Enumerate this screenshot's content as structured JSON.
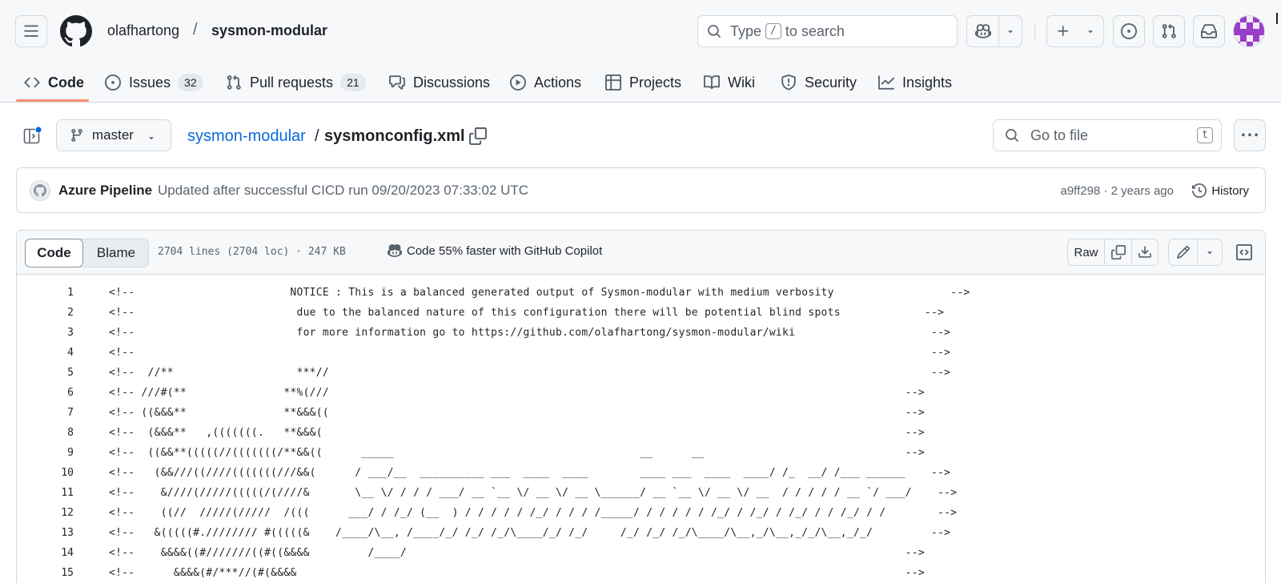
{
  "header": {
    "owner": "olafhartong",
    "separator": "/",
    "repo": "sysmon-modular",
    "search_prefix": "Type",
    "search_key": "/",
    "search_suffix": "to search"
  },
  "nav": {
    "code": "Code",
    "issues": "Issues",
    "issues_count": "32",
    "pull_requests": "Pull requests",
    "pull_requests_count": "21",
    "discussions": "Discussions",
    "actions": "Actions",
    "projects": "Projects",
    "wiki": "Wiki",
    "security": "Security",
    "insights": "Insights"
  },
  "file_header": {
    "branch": "master",
    "path_repo": "sysmon-modular",
    "path_sep": "/",
    "path_file": "sysmonconfig.xml",
    "goto_placeholder": "Go to file",
    "goto_key": "t"
  },
  "commit": {
    "author": "Azure Pipeline",
    "message": "Updated after successful CICD run 09/20/2023 07:33:02 UTC",
    "sha_time": "a9ff298 · 2 years ago",
    "history": "History"
  },
  "toolbar": {
    "code_tab": "Code",
    "blame_tab": "Blame",
    "meta": "2704 lines (2704 loc) · 247 KB",
    "copilot_hint": "Code 55% faster with GitHub Copilot",
    "raw": "Raw"
  },
  "code_lines": [
    {
      "n": "1",
      "text": "<!--                        NOTICE : This is a balanced generated output of Sysmon-modular with medium verbosity                  -->"
    },
    {
      "n": "2",
      "text": "<!--                         due to the balanced nature of this configuration there will be potential blind spots             -->"
    },
    {
      "n": "3",
      "text": "<!--                         for more information go to https://github.com/olafhartong/sysmon-modular/wiki                     -->"
    },
    {
      "n": "4",
      "text": "<!--                                                                                                                           -->"
    },
    {
      "n": "5",
      "text": "<!--  //**                   ***//                                                                                             -->"
    },
    {
      "n": "6",
      "text": "<!-- ///#(**               **%(///                                                                                         -->"
    },
    {
      "n": "7",
      "text": "<!-- ((&&&**               **&&&((                                                                                         -->"
    },
    {
      "n": "8",
      "text": "<!--  (&&&**   ,(((((((.   **&&&(                                                                                          -->"
    },
    {
      "n": "9",
      "text": "<!--  ((&&**(((((//(((((((/**&&((      _____                                      __      __                               -->"
    },
    {
      "n": "10",
      "text": "<!--   (&&///((////(((((((///&&(      / ___/__  __________ ___  ____  ____        ____ ___  ____  ____/ /_  __/ /___ ______    -->"
    },
    {
      "n": "11",
      "text": "<!--    &////(/////(((((/(////&       \\__ \\/ / / / ___/ __ `__ \\/ __ \\/ __ \\______/ __ `__ \\/ __ \\/ __  / / / / / __ `/ ___/    -->"
    },
    {
      "n": "12",
      "text": "<!--    ((//  /////(/////  /(((      ___/ / /_/ (__  ) / / / / / /_/ / / / /_____/ / / / / / /_/ / /_/ / /_/ / / /_/ / /        -->"
    },
    {
      "n": "13",
      "text": "<!--   &(((((#.//////// #(((((&    /____/\\__, /____/_/ /_/ /_/\\____/_/ /_/     /_/ /_/ /_/\\____/\\__,_/\\__,_/_/\\__,_/_/         -->"
    },
    {
      "n": "14",
      "text": "<!--    &&&&((#///////((#((&&&&         /____/                                                                             -->"
    },
    {
      "n": "15",
      "text": "<!--      &&&&(#/***//(#(&&&&                                                                                              -->"
    }
  ]
}
